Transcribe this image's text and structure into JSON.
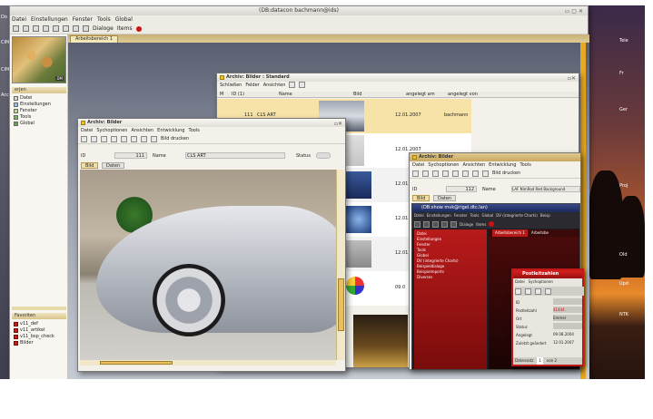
{
  "main_window": {
    "title": "(DB:datacon bachmann@ids)",
    "menu": [
      "Datei",
      "Einstellungen",
      "Fenster",
      "Tools",
      "Global"
    ],
    "toolbar": {
      "dialoge": "Dialoge",
      "items": "Items"
    },
    "tab": "Arbeitsbereich 1"
  },
  "sidebar": {
    "logo_text": "DM",
    "section_title": "erjen",
    "items": [
      "Datei",
      "Einstellungen",
      "Fenster",
      "Tools",
      "Global"
    ],
    "favorites_title": "Favoriten",
    "favorites": [
      "v11_def",
      "v11_artikel",
      "v11_bsp_check",
      "Bilder"
    ]
  },
  "archiv_standard": {
    "title": "Archiv: Bilder : Standard",
    "menu": [
      "Schließen",
      "Felder",
      "Ansichten"
    ],
    "columns": [
      "M",
      "ID (1)",
      "Name",
      "Bild",
      "angelegt am",
      "angelegt von"
    ],
    "rows": [
      {
        "id": "111",
        "name": "CLS ART",
        "date": "12.01.2007",
        "user": "bachmann"
      },
      {
        "id": "",
        "name": "",
        "date": "12.01.2007",
        "user": ""
      },
      {
        "id": "",
        "name": "",
        "date": "12.01.2007",
        "user": ""
      },
      {
        "id": "",
        "name": "",
        "date": "12.01.2007",
        "user": ""
      },
      {
        "id": "",
        "name": "",
        "date": "12.01.2007",
        "user": ""
      },
      {
        "id": "",
        "name": "",
        "date": "09.0",
        "user": ""
      }
    ]
  },
  "archiv_bilder": {
    "title": "Archiv: Bilder",
    "menu": [
      "Datei",
      "Sychoptionen",
      "Ansichten",
      "Entwicklung",
      "Tools"
    ],
    "print_label": "Bild drucken",
    "id_label": "ID",
    "id_value": "111",
    "name_label": "Name",
    "name_value": "CLS ART",
    "status_label": "Status",
    "tabs": [
      "Bild",
      "Daten"
    ]
  },
  "archiv_dark": {
    "title": "Archiv: Bilder",
    "menu": [
      "Datei",
      "Sychoptionen",
      "Ansichten",
      "Entwicklung",
      "Tools"
    ],
    "print_label": "Bild drucken",
    "id_label": "ID",
    "id_value": "112",
    "name_label": "Name",
    "name_value": "LAF NimRod Red Background",
    "tabs": [
      "Bild",
      "Daten"
    ]
  },
  "dbshow": {
    "title": "(DB:show mvk@rigel.dtc.lan)",
    "menu": [
      "Datei",
      "Einstellungen",
      "Fenster",
      "Tools",
      "Global",
      "DV (integrierte Charts)",
      "Beisp"
    ],
    "toolbar": {
      "dialoge": "Dialoge",
      "items": "Items"
    },
    "tree": [
      "Datei",
      "Einstellungen",
      "Fenster",
      "Tools",
      "Global",
      "DV (integrierte Charts)",
      "Beispieldialoge",
      "Beispielreports",
      "Diverses"
    ],
    "tabs": [
      "Arbeitsbereich 1",
      "Arbeitsbe"
    ]
  },
  "postleitzahlen": {
    "title": "Postleitzahlen",
    "menu": [
      "Datei",
      "Sychoptionen"
    ],
    "fields": [
      {
        "label": "ID",
        "value": ""
      },
      {
        "label": "Postleitzahl",
        "value": "41444"
      },
      {
        "label": "Ort",
        "value": "Emmer"
      },
      {
        "label": "Status",
        "value": ""
      },
      {
        "label": "Angelegt",
        "value": "09.08.2004"
      },
      {
        "label": "Zuletzt geändert",
        "value": "12.01.2007"
      }
    ],
    "status_left": "Datensatz",
    "status_right": "1",
    "status_of": "von 2"
  },
  "desktop_labels": [
    "Do",
    "CIM",
    "CIM",
    "Acci"
  ],
  "right_desktop_labels": [
    "Tele",
    "Fr",
    "Ger",
    "Proj",
    "Old",
    "Upd",
    "NTK"
  ]
}
